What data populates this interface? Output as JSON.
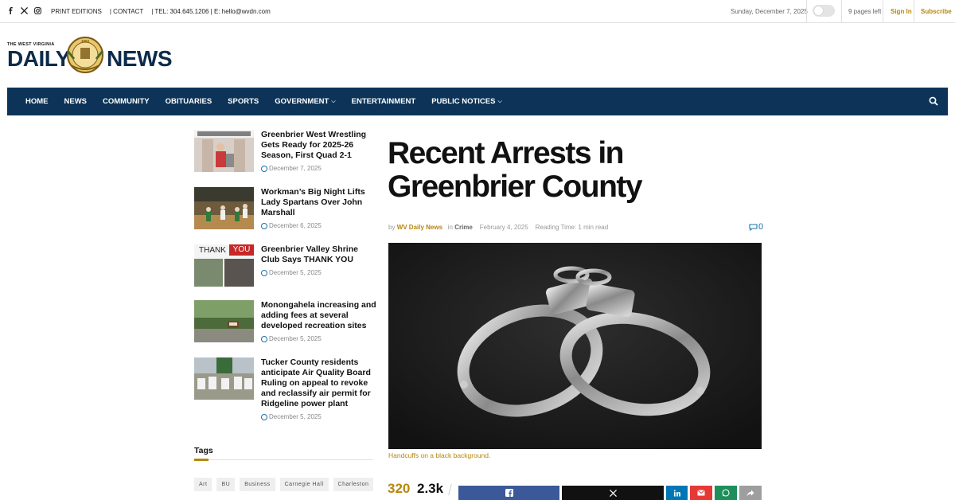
{
  "topbar": {
    "social_icons": [
      "facebook-icon",
      "x-icon",
      "instagram-icon"
    ],
    "print_editions": "PRINT EDITIONS",
    "contact": "| CONTACT",
    "contact_info": "| TEL: 304.645.1206 | E: hello@wvdn.com",
    "date": "Sunday, December 7, 2025",
    "pages_left": "9 pages left",
    "sign_in": "Sign In",
    "subscribe": "Subscribe"
  },
  "logo": {
    "small": "THE WEST VIRGINIA",
    "daily": "DAILY",
    "news": "NEWS"
  },
  "nav": {
    "items": [
      {
        "label": "HOME"
      },
      {
        "label": "NEWS"
      },
      {
        "label": "COMMUNITY"
      },
      {
        "label": "OBITUARIES"
      },
      {
        "label": "SPORTS"
      },
      {
        "label": "GOVERNMENT"
      },
      {
        "label": "ENTERTAINMENT"
      },
      {
        "label": "PUBLIC NOTICES"
      }
    ]
  },
  "sidebar": {
    "posts": [
      {
        "title": "Greenbrier West Wrestling Gets Ready for 2025-26 Season, First Quad 2-1",
        "date": "December 7, 2025"
      },
      {
        "title": "Workman’s Big Night Lifts Lady Spartans Over John Marshall",
        "date": "December 6, 2025"
      },
      {
        "title": "Greenbrier Valley Shrine Club Says THANK YOU",
        "date": "December 5, 2025",
        "thumb_text_1": "THANK",
        "thumb_text_2": "YOU"
      },
      {
        "title": "Monongahela increasing and adding fees at several developed recreation sites",
        "date": "December 5, 2025"
      },
      {
        "title": "Tucker County residents anticipate Air Quality Board Ruling on appeal to revoke and reclassify air permit for Ridgeline power plant",
        "date": "December 5, 2025"
      }
    ],
    "tags_title": "Tags",
    "tags": [
      "Art",
      "BU",
      "Business",
      "Carnegie Hall",
      "Charleston"
    ]
  },
  "article": {
    "headline": "Recent Arrests in Greenbrier County",
    "by": "by",
    "author": "WV Daily News",
    "in": "in",
    "category": "Crime",
    "date": "February 4, 2025",
    "reading_time": "Reading Time: 1 min read",
    "comment_count": "0",
    "caption": "Handcuffs on a black background.",
    "shares": "320",
    "views": "2.3k"
  },
  "colors": {
    "nav_bg": "#0d3458",
    "accent": "#b8860b",
    "link_blue": "#1a73a8",
    "facebook": "#3b5998",
    "twitter": "#111111",
    "linkedin": "#0077b5",
    "email": "#e53935",
    "whatsapp": "#1e8e5a",
    "more": "#9e9e9e"
  }
}
